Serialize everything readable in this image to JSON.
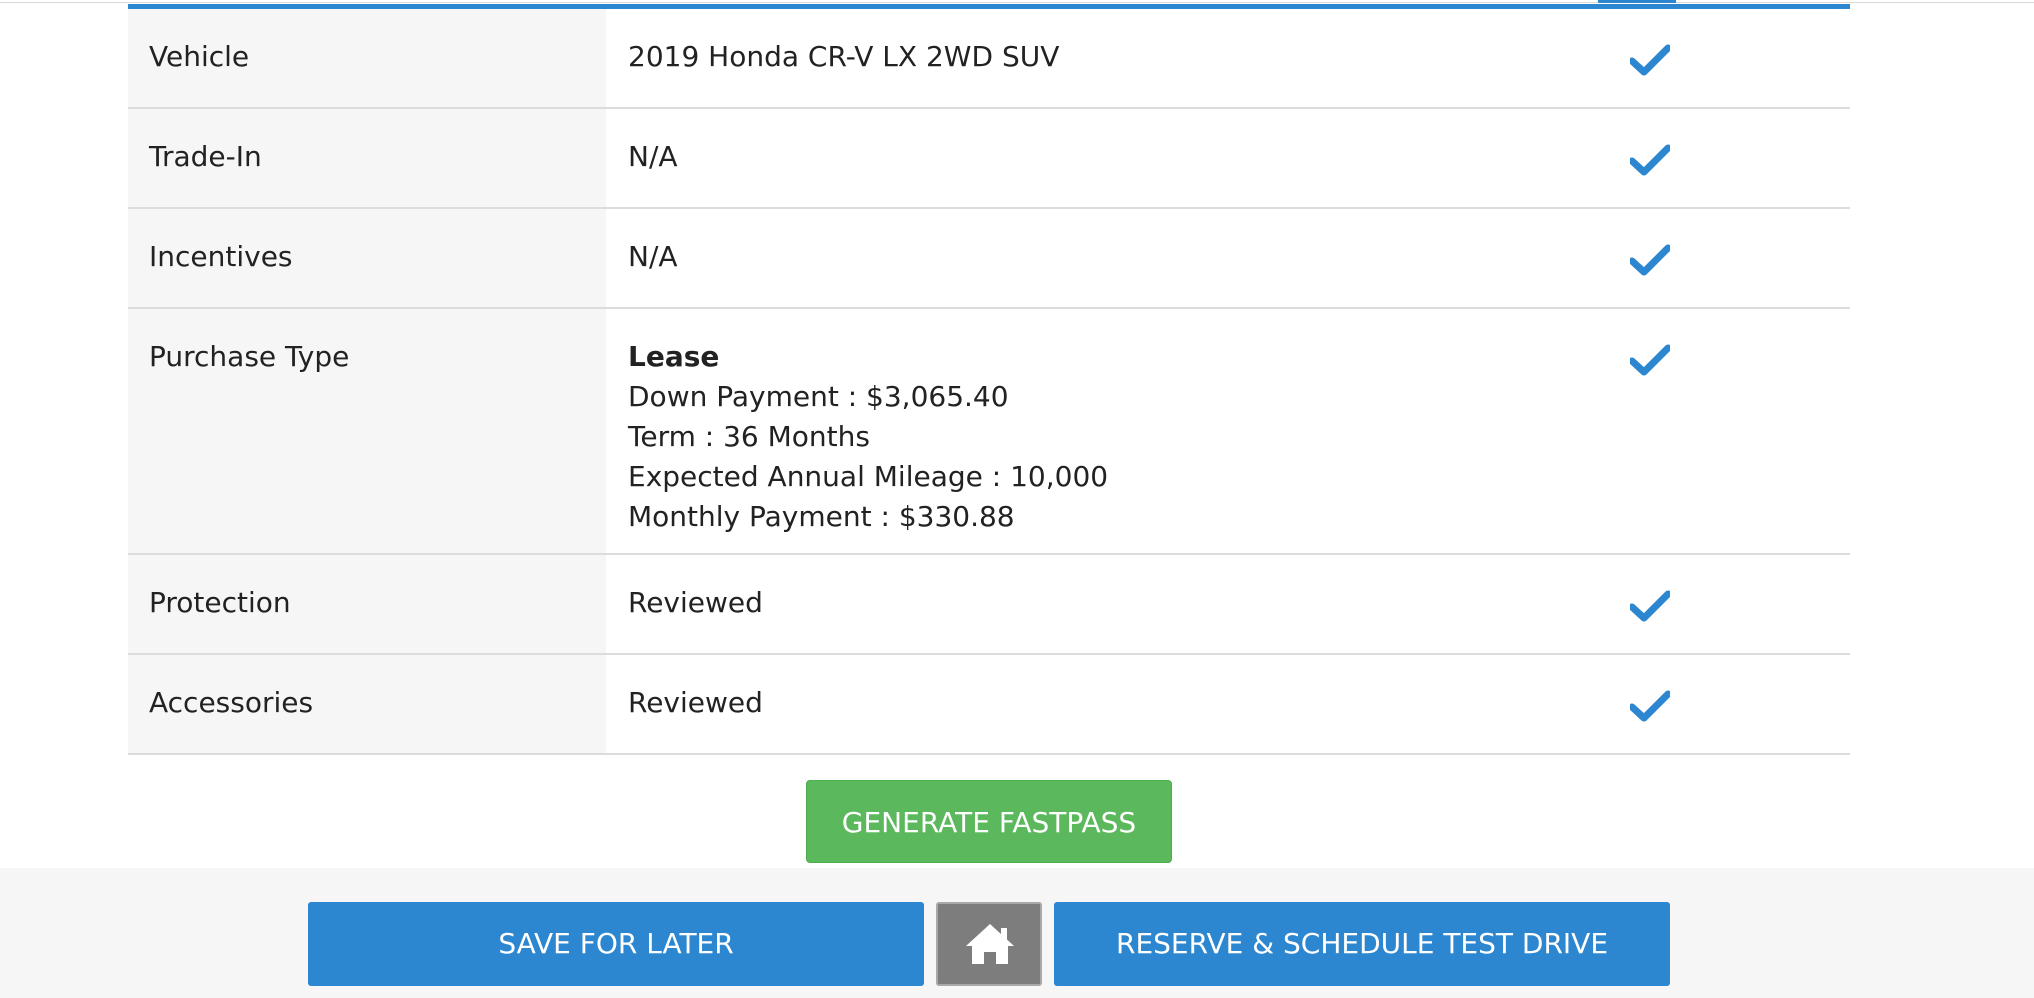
{
  "summary": {
    "rows": [
      {
        "label": "Vehicle",
        "value": "2019 Honda CR-V LX 2WD SUV"
      },
      {
        "label": "Trade-In",
        "value": "N/A"
      },
      {
        "label": "Incentives",
        "value": "N/A"
      },
      {
        "label": "Purchase Type",
        "title": "Lease",
        "lines": [
          "Down Payment : $3,065.40",
          "Term : 36 Months",
          "Expected Annual Mileage : 10,000",
          "Monthly Payment : $330.88"
        ]
      },
      {
        "label": "Protection",
        "value": "Reviewed"
      },
      {
        "label": "Accessories",
        "value": "Reviewed"
      }
    ]
  },
  "actions": {
    "generate_label": "GENERATE FASTPASS"
  },
  "footer": {
    "save_label": "SAVE FOR LATER",
    "reserve_label": "RESERVE & SCHEDULE TEST DRIVE"
  },
  "colors": {
    "accent": "#2d87d0",
    "success": "#5cb85c",
    "neutral": "#7d7d7d"
  },
  "icons": {
    "row_status": "checkmark-icon",
    "home": "home-icon"
  }
}
